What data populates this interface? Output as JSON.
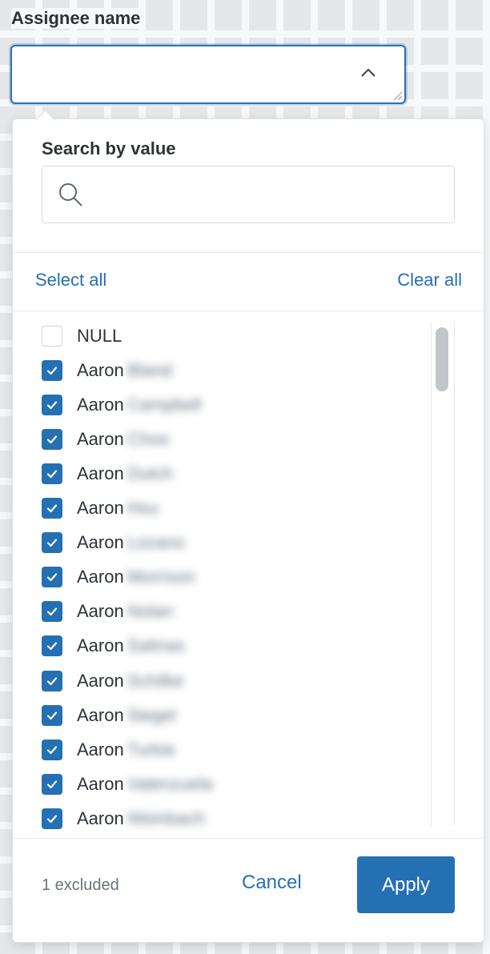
{
  "field": {
    "label": "Assignee name",
    "value": ""
  },
  "icons": {
    "chevron": "chevron-up-icon",
    "search": "search-icon",
    "check": "check-icon"
  },
  "colors": {
    "accent": "#2470b3",
    "border": "#dde1e5",
    "text": "#2e3338",
    "muted": "#6a737c"
  },
  "search": {
    "title": "Search by value",
    "value": "",
    "placeholder": ""
  },
  "actions": {
    "select_all": "Select all",
    "clear_all": "Clear all"
  },
  "options": [
    {
      "first": "NULL",
      "last": "",
      "checked": false
    },
    {
      "first": "Aaron",
      "last": "Bland",
      "checked": true
    },
    {
      "first": "Aaron",
      "last": "Campbell",
      "checked": true
    },
    {
      "first": "Aaron",
      "last": "Choo",
      "checked": true
    },
    {
      "first": "Aaron",
      "last": "Dutch",
      "checked": true
    },
    {
      "first": "Aaron",
      "last": "Hsu",
      "checked": true
    },
    {
      "first": "Aaron",
      "last": "Lozano",
      "checked": true
    },
    {
      "first": "Aaron",
      "last": "Morrison",
      "checked": true
    },
    {
      "first": "Aaron",
      "last": "Nolan",
      "checked": true
    },
    {
      "first": "Aaron",
      "last": "Salinas",
      "checked": true
    },
    {
      "first": "Aaron",
      "last": "Schilke",
      "checked": true
    },
    {
      "first": "Aaron",
      "last": "Siegel",
      "checked": true
    },
    {
      "first": "Aaron",
      "last": "Turkie",
      "checked": true
    },
    {
      "first": "Aaron",
      "last": "Valenzuela",
      "checked": true
    },
    {
      "first": "Aaron",
      "last": "Weinbach",
      "checked": true
    }
  ],
  "footer": {
    "excluded": "1 excluded",
    "cancel": "Cancel",
    "apply": "Apply"
  }
}
